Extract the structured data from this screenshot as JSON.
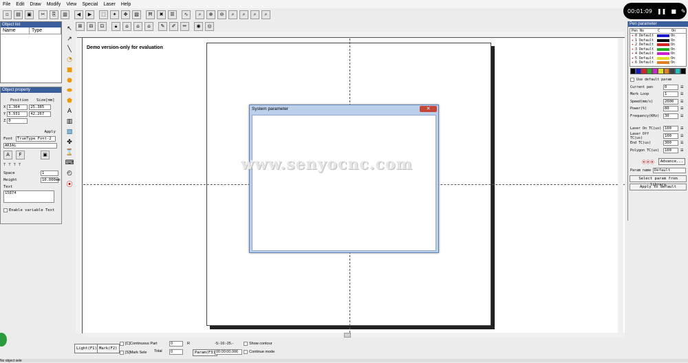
{
  "menu": [
    "File",
    "Edit",
    "Draw",
    "Modify",
    "View",
    "Special",
    "Laser",
    "Help"
  ],
  "recording": {
    "time": "00:01:09"
  },
  "object_list": {
    "title": "Object list",
    "col_name": "Name",
    "col_type": "Type"
  },
  "object_property": {
    "title": "Object property",
    "position_label": "Position",
    "size_label": "Size[mm]",
    "x_label": "X",
    "x_pos": "1.364",
    "x_size": "25.385",
    "y_label": "Y",
    "y_pos": "5.931",
    "y_size": "42.267",
    "z_label": "Z",
    "z_pos": "0",
    "apply": "Apply",
    "font_label": "Font",
    "font_value": "TrueType Font-2",
    "font_name": "ARIAL",
    "space_label": "Space",
    "space_value": "1",
    "height_label": "Height",
    "height_value": "10.000mm",
    "text_label": "Text",
    "text_value": "15874",
    "variable_text": "Enable variable Text"
  },
  "canvas": {
    "demo_text": "Demo version-only for evaluation"
  },
  "dialog": {
    "title": "System parameter",
    "close": "✕"
  },
  "watermark": "www.senyocnc.com",
  "pen_panel": {
    "title": "Pen parameter",
    "col_pen": "Pen No",
    "col_c": "C",
    "col_on": "On",
    "pens": [
      {
        "label": "0 Default",
        "color": "#1a1acc",
        "on": "On"
      },
      {
        "label": "1 Default",
        "color": "#000000",
        "on": "On"
      },
      {
        "label": "2 Default",
        "color": "#e02020",
        "on": "On"
      },
      {
        "label": "3 Default",
        "color": "#20b020",
        "on": "On"
      },
      {
        "label": "4 Default",
        "color": "#d020d0",
        "on": "On"
      },
      {
        "label": "5 Default",
        "color": "#e0e020",
        "on": "On"
      },
      {
        "label": "6 Default",
        "color": "#e08020",
        "on": "On"
      }
    ],
    "palette": [
      "#000000",
      "#1a1acc",
      "#e02020",
      "#20b020",
      "#d020d0",
      "#e0e020",
      "#e08020",
      "#404040",
      "#20c0c0",
      "#000000"
    ],
    "use_default": "Use default param",
    "params": [
      {
        "label": "Current pen",
        "value": "0"
      },
      {
        "label": "Mark Loop",
        "value": "1"
      },
      {
        "label": "Speed(mm/s)",
        "value": "2000"
      },
      {
        "label": "Power(%)",
        "value": "80"
      },
      {
        "label": "Frequency(KHz)",
        "value": "30"
      },
      {
        "label": "Laser On TC(us)",
        "value": "100"
      },
      {
        "label": "Laser Off TC(us)",
        "value": "100"
      },
      {
        "label": "End TC(us)",
        "value": "300"
      },
      {
        "label": "Polygon TC(us)",
        "value": "100"
      }
    ],
    "advance": "Advance...",
    "param_name_label": "Param name",
    "param_name_value": "Default",
    "select_library": "Select param from library",
    "apply_default": "Apply to default"
  },
  "bottom": {
    "light": "Light(F1)",
    "mark": "Mark(F2)",
    "continuous": "[C]Continuous Part",
    "part_value": "0",
    "r": "R",
    "mark_sele": "[S]Mark Sele",
    "total_label": "Total",
    "total_value": "0",
    "coord": "-5:-16:-25.-",
    "param": "Param(F3)",
    "time": "00:00:00.006",
    "show_contour": "Show contour",
    "continue_mode": "Continue mode"
  },
  "status": {
    "text": "No object sele"
  }
}
